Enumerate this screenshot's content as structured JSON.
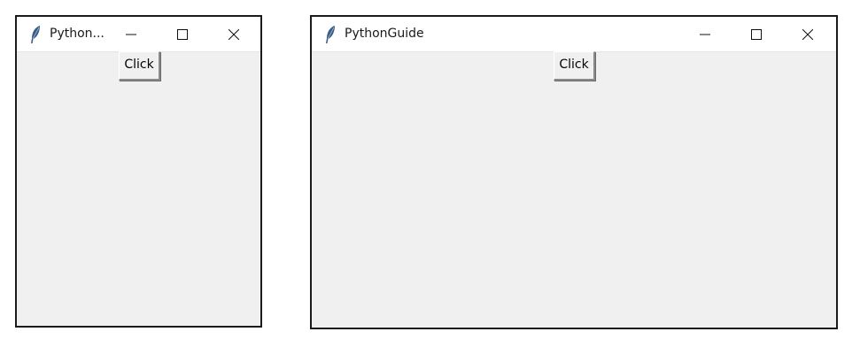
{
  "windows": [
    {
      "title": "Python...",
      "button_label": "Click",
      "controls": {
        "minimize": "minimize-icon",
        "maximize": "maximize-icon",
        "close": "close-icon"
      }
    },
    {
      "title": "PythonGuide",
      "button_label": "Click",
      "controls": {
        "minimize": "minimize-icon",
        "maximize": "maximize-icon",
        "close": "close-icon"
      }
    }
  ],
  "app_icon": "feather-icon",
  "colors": {
    "window_body": "#f0f0f0",
    "titlebar": "#ffffff",
    "border": "#1b1b1b"
  }
}
